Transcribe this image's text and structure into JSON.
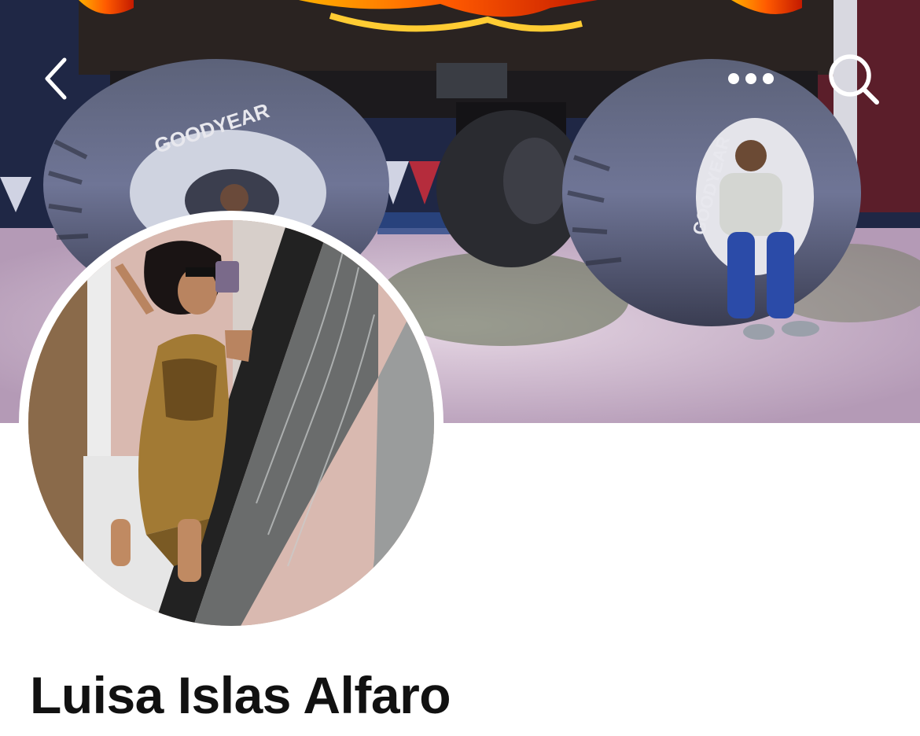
{
  "header": {
    "back_icon": "chevron-left-icon",
    "more_icon": "ellipsis-icon",
    "search_icon": "search-icon"
  },
  "cover_photo": {
    "tire_brand_left": "GOODYEAR",
    "tire_brand_right": "GOODYEAR"
  },
  "profile": {
    "name": "Luisa Islas Alfaro"
  },
  "colors": {
    "icon": "#ffffff",
    "name_text": "#111111",
    "background": "#ffffff"
  }
}
